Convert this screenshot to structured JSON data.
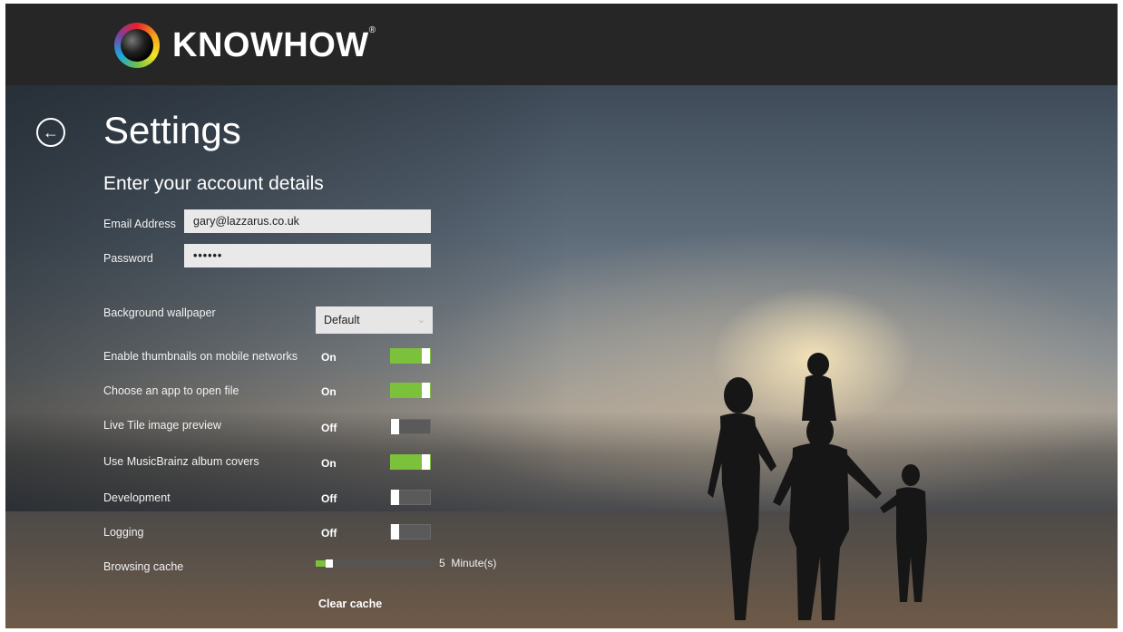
{
  "app": {
    "logo_text": "KNOWHOW",
    "logo_reg": "®"
  },
  "page": {
    "title": "Settings",
    "subtitle": "Enter your account details"
  },
  "account": {
    "email_label": "Email Address",
    "email_value": "gary@lazzarus.co.uk",
    "password_label": "Password",
    "password_value": "••••••"
  },
  "wallpaper": {
    "label": "Background wallpaper",
    "selected": "Default"
  },
  "toggles": [
    {
      "label": "Enable thumbnails on mobile networks",
      "state": "On"
    },
    {
      "label": "Choose an app to open file",
      "state": "On"
    },
    {
      "label": "Live Tile image preview",
      "state": "Off"
    },
    {
      "label": "Use MusicBrainz album covers",
      "state": "On"
    },
    {
      "label": "Development",
      "state": "Off"
    },
    {
      "label": "Logging",
      "state": "Off"
    }
  ],
  "cache": {
    "label": "Browsing cache",
    "value": "5",
    "unit": "Minute(s)",
    "fraction": 0.12,
    "clear_label": "Clear cache"
  },
  "colors": {
    "accent": "#7cc13b",
    "topbar": "#262626"
  },
  "icons": {
    "back": "back-arrow-icon",
    "dropdown": "chevron-down-icon"
  }
}
